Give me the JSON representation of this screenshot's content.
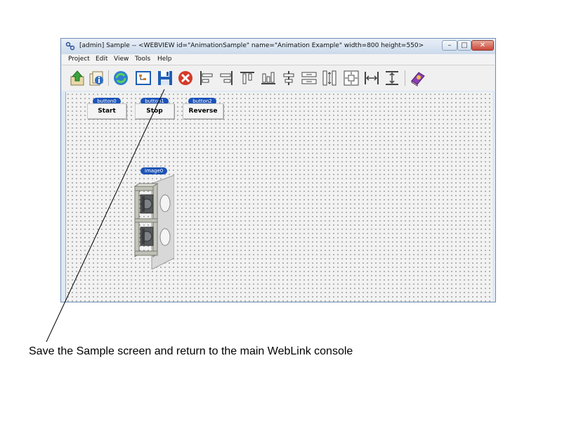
{
  "window": {
    "title": "[admin]  Sample  --  <WEBVIEW id=\"AnimationSample\" name=\"Animation Example\" width=800 height=550>",
    "controls": {
      "minimize": "–",
      "maximize": "□",
      "close": "✕"
    }
  },
  "menu": [
    "Project",
    "Edit",
    "View",
    "Tools",
    "Help"
  ],
  "toolbar": {
    "buttons": [
      "export-icon",
      "properties-icon",
      "refresh-icon",
      "object-tree-icon",
      "save-icon",
      "delete-icon",
      "align-left-icon",
      "align-right-icon",
      "align-top-icon",
      "align-bottom-icon",
      "center-vertical-icon",
      "center-horizontal-icon",
      "space-vertical-icon",
      "center-both-icon",
      "same-width-icon",
      "same-height-icon",
      "help-book-icon"
    ]
  },
  "canvas": {
    "buttons": [
      {
        "tag": "button0",
        "label": "Start"
      },
      {
        "tag": "button1",
        "label": "Stop"
      },
      {
        "tag": "button2",
        "label": "Reverse"
      }
    ],
    "image": {
      "tag": "image0",
      "content": "3d-machine-frame"
    }
  },
  "annotation": {
    "caption": "Save the Sample screen and return to the main WebLink console"
  },
  "colors": {
    "tag_badge": "#1b53b8",
    "canvas_bg": "#f2f2f2",
    "save_icon": "#1f5fb5",
    "delete_icon": "#d63a2a"
  }
}
